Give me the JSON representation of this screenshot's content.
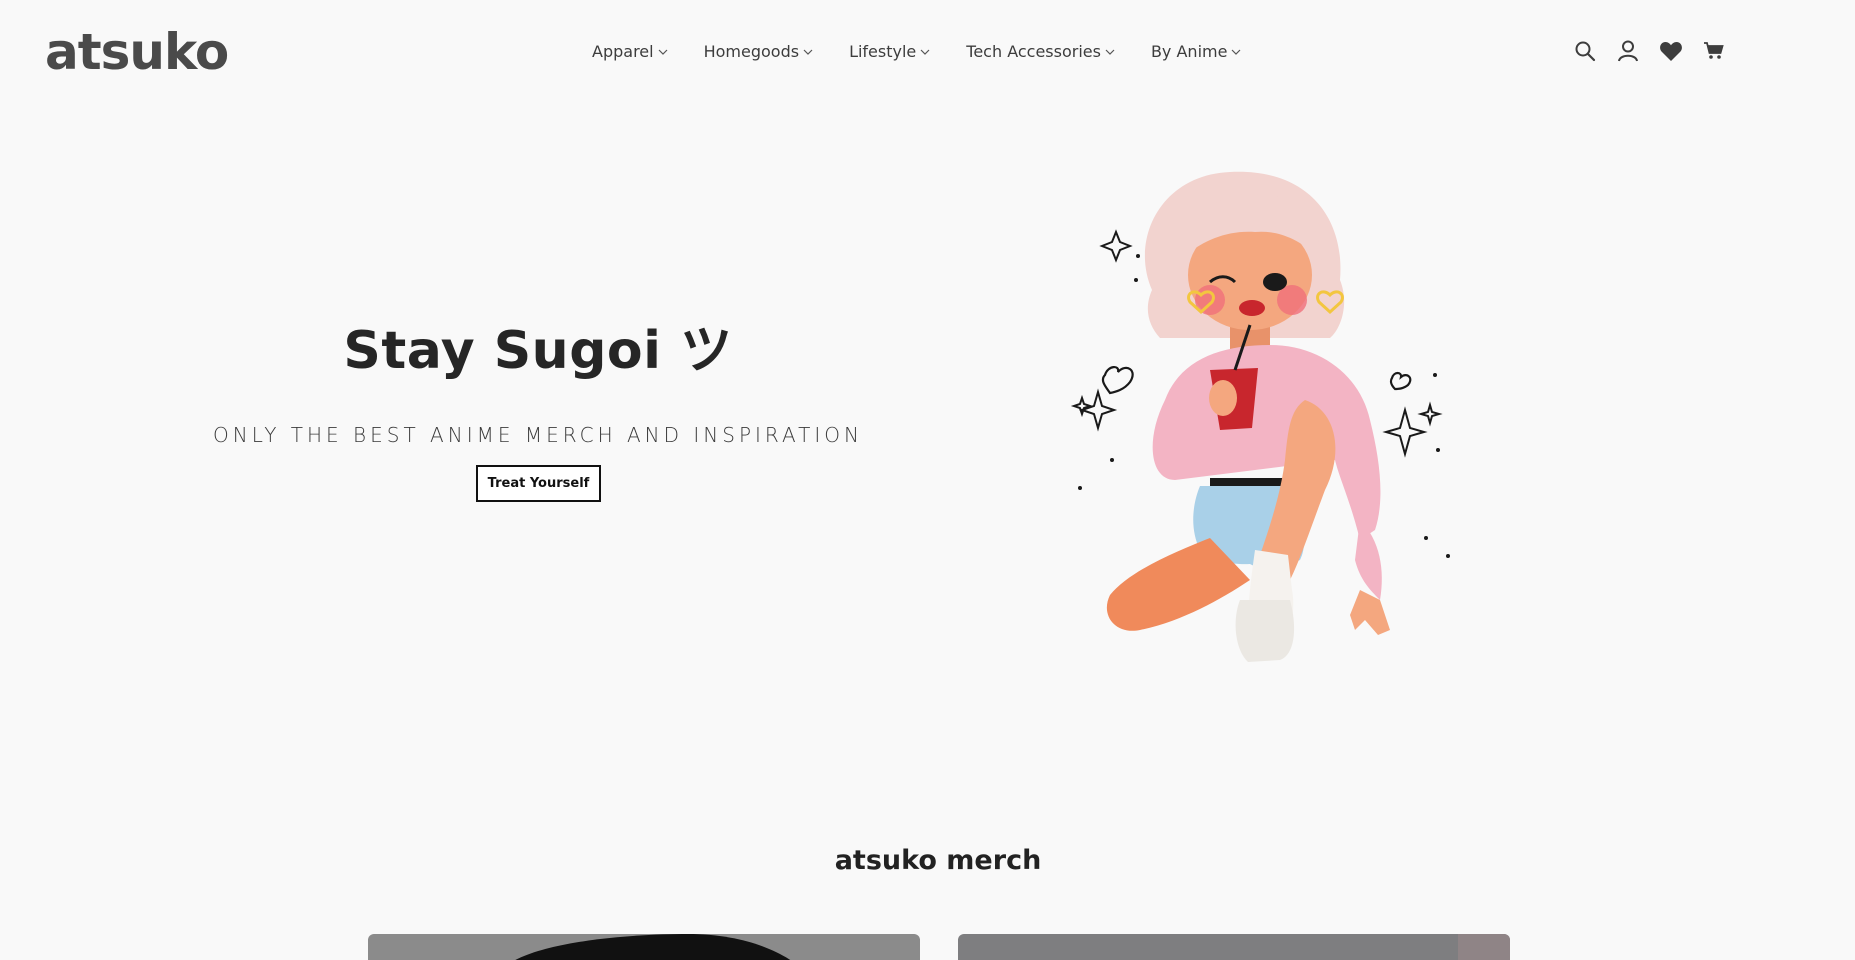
{
  "header": {
    "logo": "atsuko",
    "nav": [
      {
        "label": "Apparel"
      },
      {
        "label": "Homegoods"
      },
      {
        "label": "Lifestyle"
      },
      {
        "label": "Tech Accessories"
      },
      {
        "label": "By Anime"
      }
    ],
    "icons": [
      "search-icon",
      "account-icon",
      "wishlist-heart-icon",
      "cart-icon"
    ]
  },
  "hero": {
    "title": "Stay Sugoi ツ",
    "subtitle": "ONLY THE BEST ANIME MERCH AND INSPIRATION",
    "cta_label": "Treat Yourself"
  },
  "section": {
    "title": "atsuko merch"
  },
  "colors": {
    "background": "#f9f9f9",
    "text": "#2b2b2b",
    "pink": "#f3b4c4",
    "skin": "#f4a77f",
    "hair": "#f2d3cf",
    "denim": "#a9d0e8",
    "cup": "#c8262d"
  }
}
